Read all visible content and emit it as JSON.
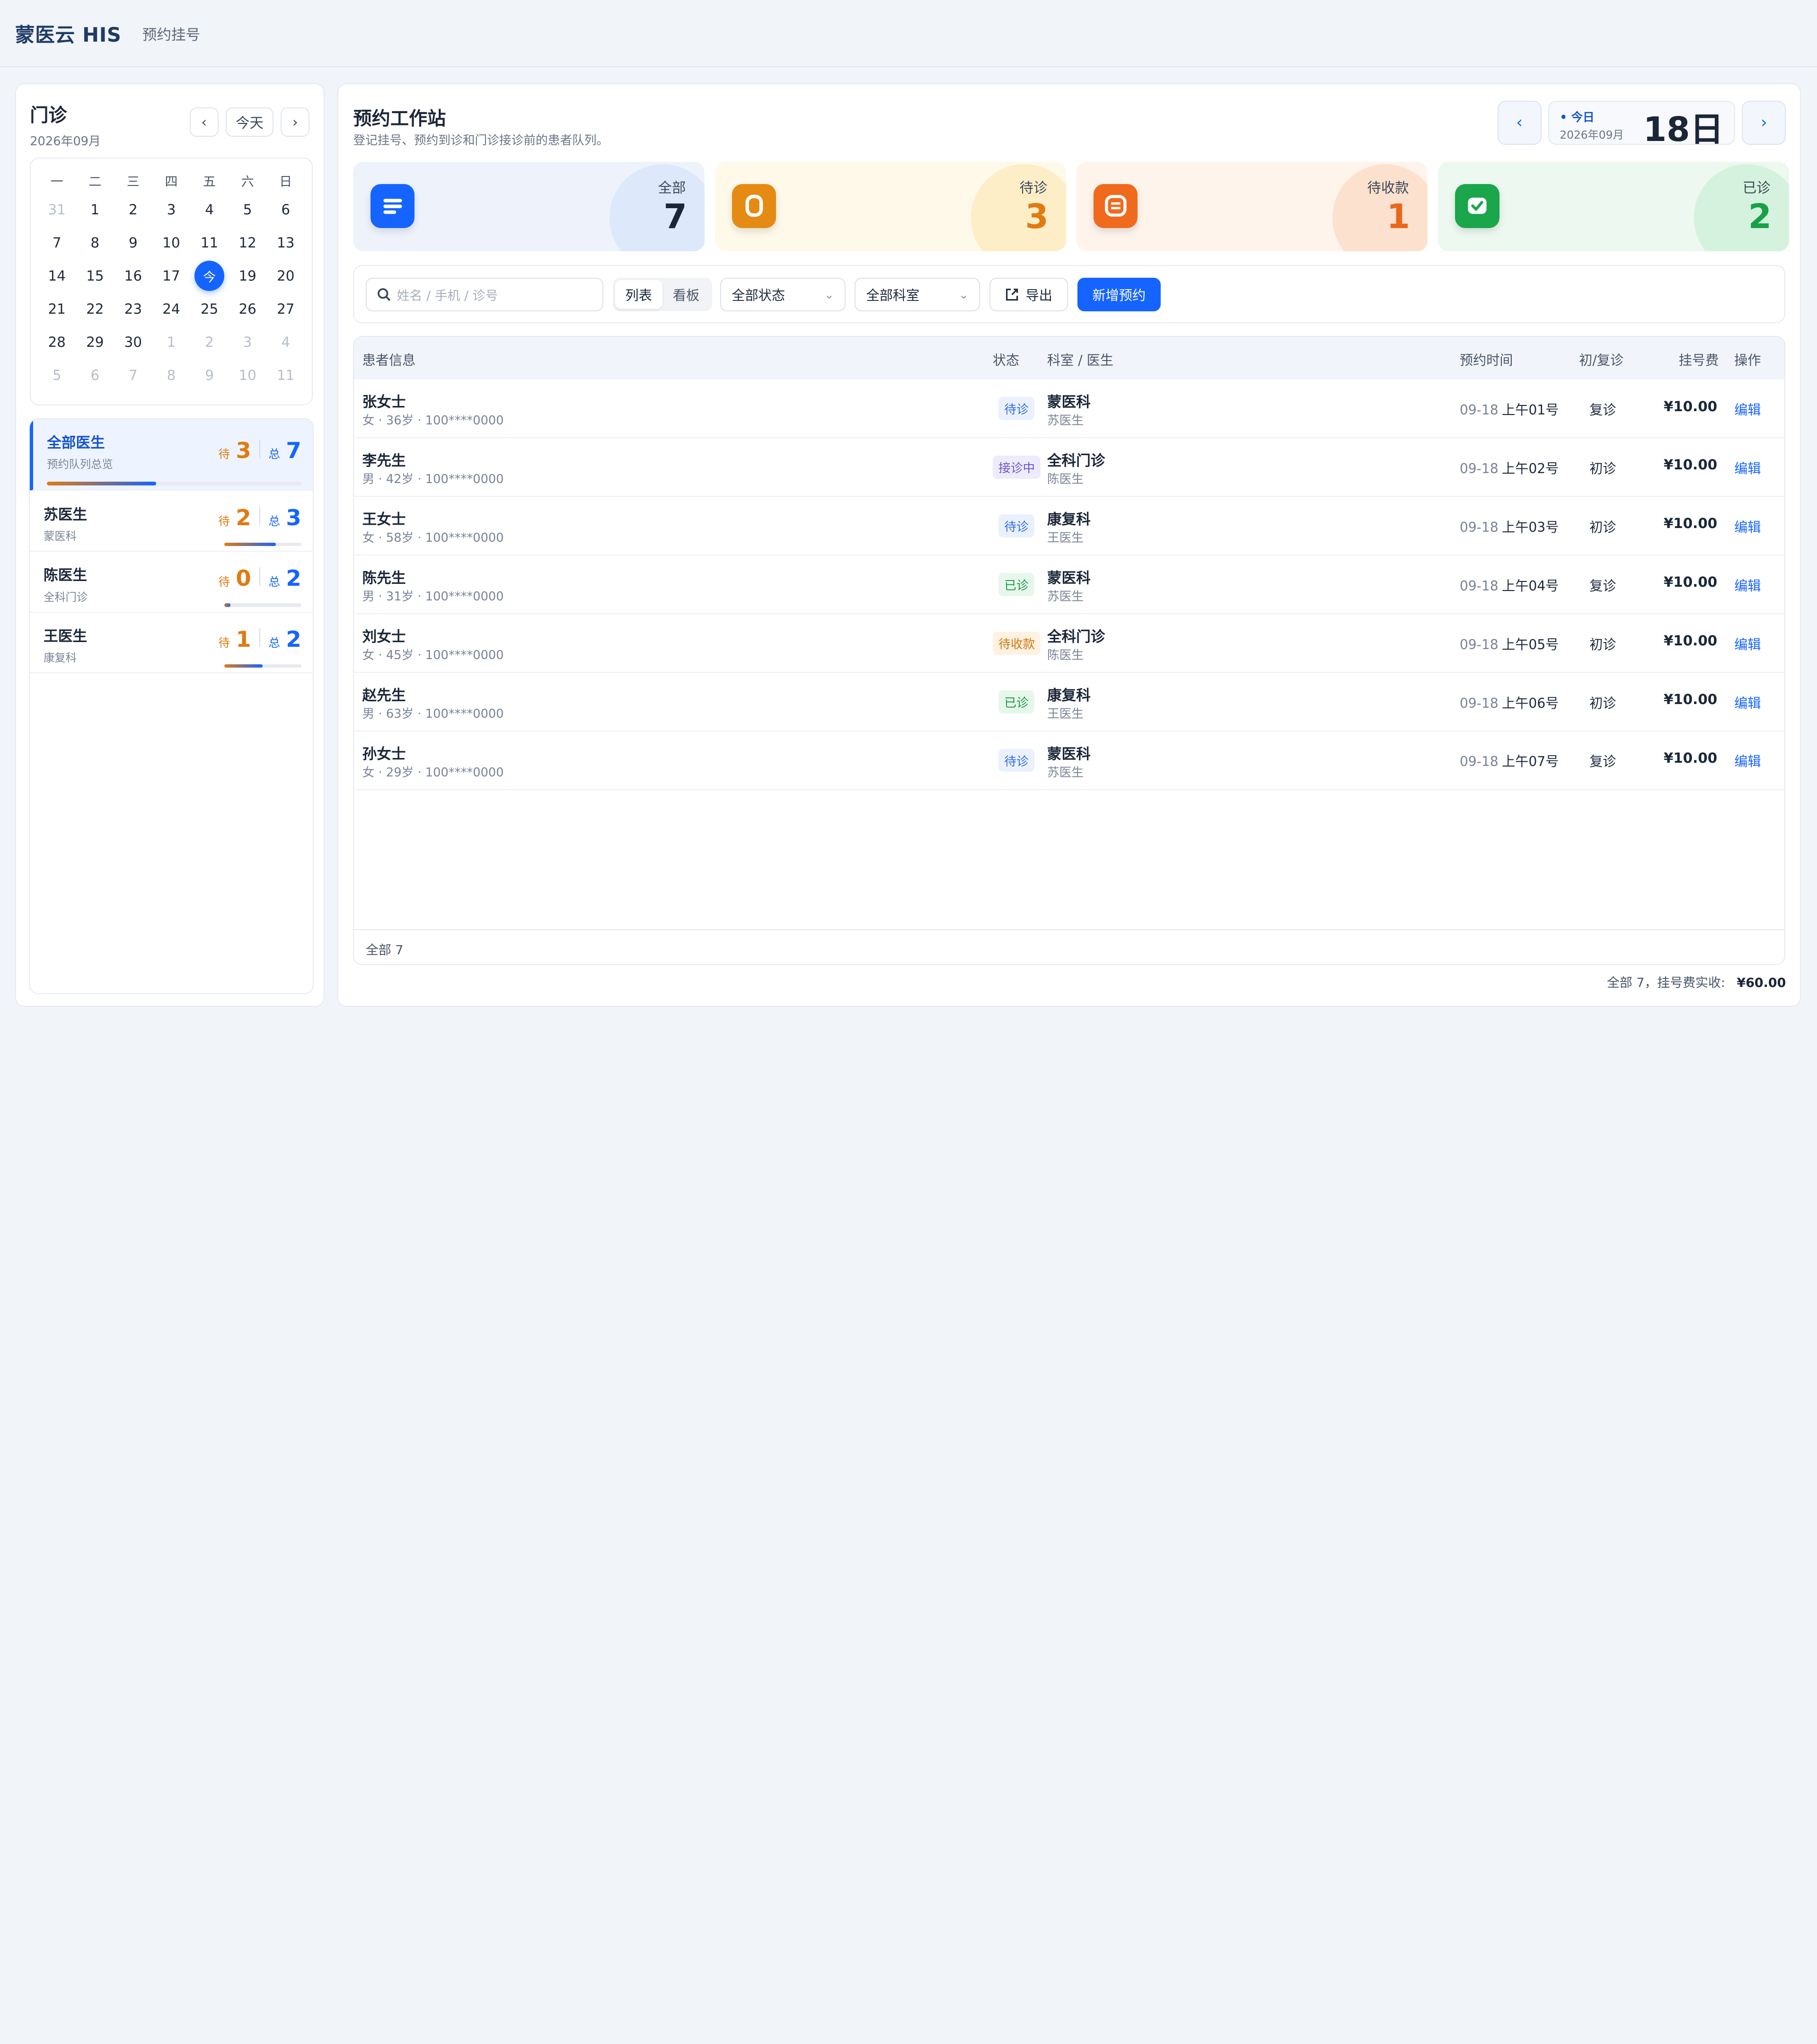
{
  "app": {
    "brand": "蒙医云 HIS",
    "crumb": "预约挂号"
  },
  "left": {
    "title": "门诊",
    "month": "2026年09月",
    "today_btn": "今天",
    "weekdays": [
      "一",
      "二",
      "三",
      "四",
      "五",
      "六",
      "日"
    ],
    "days": [
      {
        "t": "31",
        "dim": true
      },
      {
        "t": "1"
      },
      {
        "t": "2"
      },
      {
        "t": "3"
      },
      {
        "t": "4"
      },
      {
        "t": "5"
      },
      {
        "t": "6"
      },
      {
        "t": "7"
      },
      {
        "t": "8"
      },
      {
        "t": "9"
      },
      {
        "t": "10"
      },
      {
        "t": "11"
      },
      {
        "t": "12"
      },
      {
        "t": "13"
      },
      {
        "t": "14"
      },
      {
        "t": "15"
      },
      {
        "t": "16"
      },
      {
        "t": "17"
      },
      {
        "t": "今",
        "today": true
      },
      {
        "t": "19"
      },
      {
        "t": "20"
      },
      {
        "t": "21"
      },
      {
        "t": "22"
      },
      {
        "t": "23"
      },
      {
        "t": "24"
      },
      {
        "t": "25"
      },
      {
        "t": "26"
      },
      {
        "t": "27"
      },
      {
        "t": "28"
      },
      {
        "t": "29"
      },
      {
        "t": "30"
      },
      {
        "t": "1",
        "dim": true
      },
      {
        "t": "2",
        "dim": true
      },
      {
        "t": "3",
        "dim": true
      },
      {
        "t": "4",
        "dim": true
      },
      {
        "t": "5",
        "dim": true
      },
      {
        "t": "6",
        "dim": true
      },
      {
        "t": "7",
        "dim": true
      },
      {
        "t": "8",
        "dim": true
      },
      {
        "t": "9",
        "dim": true
      },
      {
        "t": "10",
        "dim": true
      },
      {
        "t": "11",
        "dim": true
      }
    ],
    "wait_label": "待",
    "total_label": "总",
    "doctors": [
      {
        "name": "全部医生",
        "dept": "预约队列总览",
        "wait": "3",
        "total": "7",
        "progress": 0.43,
        "active": true
      },
      {
        "name": "苏医生",
        "dept": "蒙医科",
        "wait": "2",
        "total": "3",
        "progress": 0.67
      },
      {
        "name": "陈医生",
        "dept": "全科门诊",
        "wait": "0",
        "total": "2",
        "progress": 0.08
      },
      {
        "name": "王医生",
        "dept": "康复科",
        "wait": "1",
        "total": "2",
        "progress": 0.5
      }
    ]
  },
  "main": {
    "title": "预约工作站",
    "subtitle": "登记挂号、预约到诊和门诊接诊前的患者队列。",
    "date": {
      "today_label": "• 今日",
      "month": "2026年09月",
      "day": "18日"
    },
    "stats": [
      {
        "label": "全部",
        "value": "7",
        "icon": "list-icon"
      },
      {
        "label": "待诊",
        "value": "3",
        "icon": "pending-icon"
      },
      {
        "label": "待收款",
        "value": "1",
        "icon": "payment-icon"
      },
      {
        "label": "已诊",
        "value": "2",
        "icon": "check-icon"
      }
    ],
    "toolbar": {
      "search_placeholder": "姓名 / 手机 / 诊号",
      "view_list": "列表",
      "view_board": "看板",
      "status_filter": "全部状态",
      "dept_filter": "全部科室",
      "export": "导出",
      "new": "新增预约"
    },
    "columns": [
      "患者信息",
      "状态",
      "科室 / 医生",
      "预约时间",
      "初/复诊",
      "挂号费",
      "操作"
    ],
    "rows": [
      {
        "name": "张女士",
        "meta": "女 · 36岁 · 100****0000",
        "status": "待诊",
        "status_type": "wait",
        "dept": "蒙医科",
        "doctor": "苏医生",
        "date": "09-18",
        "slot": "上午01号",
        "visit": "复诊",
        "fee": "¥10.00",
        "action": "编辑"
      },
      {
        "name": "李先生",
        "meta": "男 · 42岁 · 100****0000",
        "status": "接诊中",
        "status_type": "ing",
        "dept": "全科门诊",
        "doctor": "陈医生",
        "date": "09-18",
        "slot": "上午02号",
        "visit": "初诊",
        "fee": "¥10.00",
        "action": "编辑"
      },
      {
        "name": "王女士",
        "meta": "女 · 58岁 · 100****0000",
        "status": "待诊",
        "status_type": "wait",
        "dept": "康复科",
        "doctor": "王医生",
        "date": "09-18",
        "slot": "上午03号",
        "visit": "初诊",
        "fee": "¥10.00",
        "action": "编辑"
      },
      {
        "name": "陈先生",
        "meta": "男 · 31岁 · 100****0000",
        "status": "已诊",
        "status_type": "done",
        "dept": "蒙医科",
        "doctor": "苏医生",
        "date": "09-18",
        "slot": "上午04号",
        "visit": "复诊",
        "fee": "¥10.00",
        "action": "编辑"
      },
      {
        "name": "刘女士",
        "meta": "女 · 45岁 · 100****0000",
        "status": "待收款",
        "status_type": "pay",
        "dept": "全科门诊",
        "doctor": "陈医生",
        "date": "09-18",
        "slot": "上午05号",
        "visit": "初诊",
        "fee": "¥10.00",
        "action": "编辑"
      },
      {
        "name": "赵先生",
        "meta": "男 · 63岁 · 100****0000",
        "status": "已诊",
        "status_type": "done",
        "dept": "康复科",
        "doctor": "王医生",
        "date": "09-18",
        "slot": "上午06号",
        "visit": "初诊",
        "fee": "¥10.00",
        "action": "编辑"
      },
      {
        "name": "孙女士",
        "meta": "女 · 29岁 · 100****0000",
        "status": "待诊",
        "status_type": "wait",
        "dept": "蒙医科",
        "doctor": "苏医生",
        "date": "09-18",
        "slot": "上午07号",
        "visit": "复诊",
        "fee": "¥10.00",
        "action": "编辑"
      }
    ],
    "footer_total": "全部 7",
    "summary_text": "全部 7，挂号费实收:",
    "summary_amount": "¥60.00"
  }
}
